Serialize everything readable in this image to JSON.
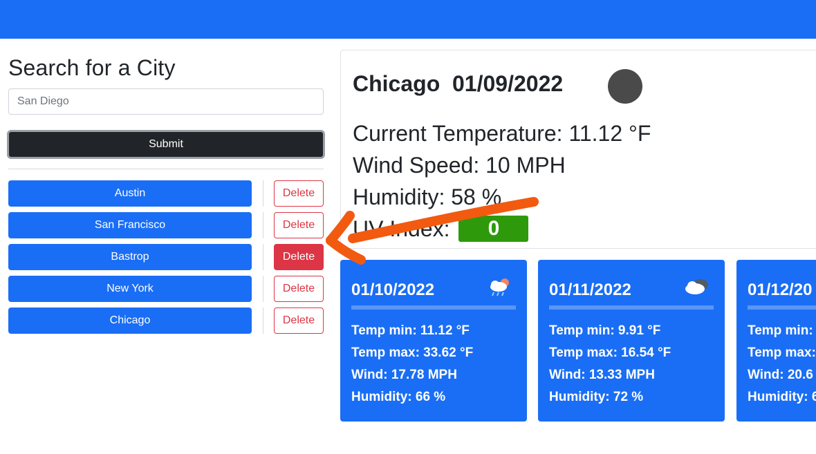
{
  "search": {
    "title": "Search for a City",
    "input_value": "San Diego",
    "submit_label": "Submit"
  },
  "history": [
    {
      "city": "Austin",
      "delete_label": "Delete"
    },
    {
      "city": "San Francisco",
      "delete_label": "Delete"
    },
    {
      "city": "Bastrop",
      "delete_label": "Delete"
    },
    {
      "city": "New York",
      "delete_label": "Delete"
    },
    {
      "city": "Chicago",
      "delete_label": "Delete"
    }
  ],
  "current": {
    "city": "Chicago",
    "date": "01/09/2022",
    "icon": "weather-icon",
    "temperature_line": "Current Temperature: 11.12 °F",
    "wind_line": "Wind Speed: 10 MPH",
    "humidity_line": "Humidity: 58 %",
    "uv_label": "UV Index:",
    "uv_value": "0"
  },
  "forecast": [
    {
      "date": "01/10/2022",
      "icon": "rain-cloud-icon",
      "temp_min": "Temp min: 11.12 °F",
      "temp_max": "Temp max: 33.62 °F",
      "wind": "Wind: 17.78 MPH",
      "humidity": "Humidity: 66 %"
    },
    {
      "date": "01/11/2022",
      "icon": "cloud-icon",
      "temp_min": "Temp min: 9.91 °F",
      "temp_max": "Temp max: 16.54 °F",
      "wind": "Wind: 13.33 MPH",
      "humidity": "Humidity: 72 %"
    },
    {
      "date": "01/12/20",
      "icon": "",
      "temp_min": "Temp min:",
      "temp_max": "Temp max:",
      "wind": "Wind: 20.6",
      "humidity": "Humidity: 6"
    }
  ],
  "colors": {
    "primary": "#1a6ef5",
    "danger": "#dc3545",
    "dark": "#212529",
    "uv_low": "#2e9a0b",
    "annotation_arrow": "#f25a10"
  }
}
